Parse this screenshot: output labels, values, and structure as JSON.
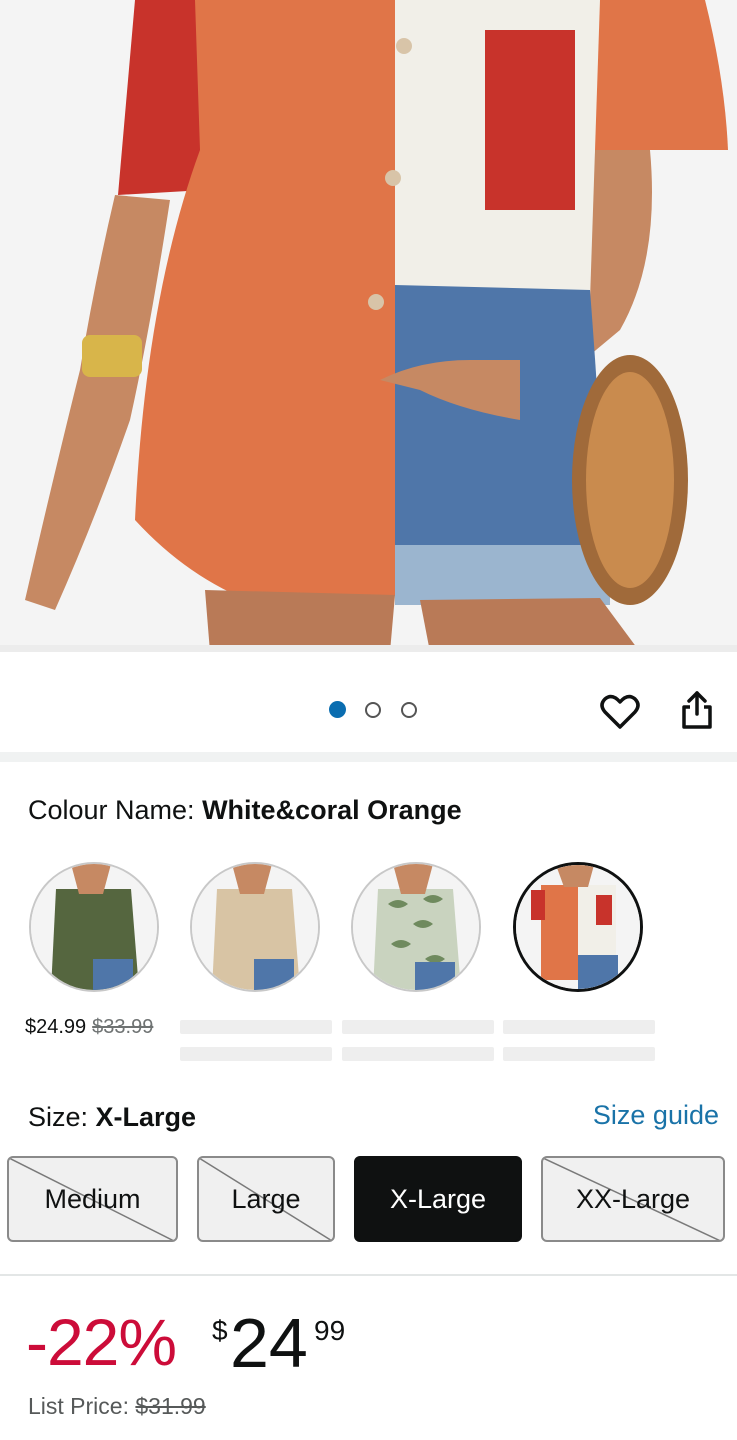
{
  "product_image": {
    "alt_icon": "product-photo",
    "pager": {
      "total": 3,
      "active": 1
    }
  },
  "actions": {
    "wishlist_icon": "heart-icon",
    "share_icon": "share-icon"
  },
  "colour": {
    "label": "Colour Name: ",
    "value": "White&coral Orange",
    "swatches": [
      {
        "name": "Army Green",
        "price": "$24.99",
        "list_price": "$33.99",
        "color": "#55663f"
      },
      {
        "name": "Khaki",
        "price": "",
        "list_price": "",
        "color": "#d8c4a4"
      },
      {
        "name": "Green Leaf Print",
        "price": "",
        "list_price": "",
        "color": "#9fae8e"
      },
      {
        "name": "White&coral Orange",
        "price": "",
        "list_price": "",
        "color": "#e07548",
        "selected": true
      }
    ]
  },
  "size": {
    "label": "Size: ",
    "value": "X-Large",
    "guide_link": "Size guide",
    "options": [
      {
        "label": "Medium",
        "available": false
      },
      {
        "label": "Large",
        "available": false
      },
      {
        "label": "X-Large",
        "available": true,
        "selected": true
      },
      {
        "label": "XX-Large",
        "available": false
      }
    ]
  },
  "pricing": {
    "discount": "-22%",
    "currency": "$",
    "whole": "24",
    "fraction": "99",
    "list_label": "List Price: ",
    "list_price": "$31.99"
  },
  "colors": {
    "accent_blue": "#0a6db0",
    "link_blue": "#1a73a8",
    "deal_red": "#cc0c39"
  }
}
